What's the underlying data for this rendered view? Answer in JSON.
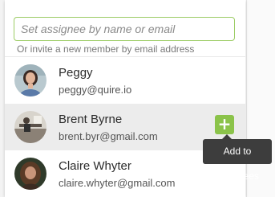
{
  "search": {
    "placeholder": "Set assignee by name or email",
    "value": ""
  },
  "hint": "Or invite a new member by email address",
  "members": [
    {
      "name": "Peggy",
      "email": "peggy@quire.io"
    },
    {
      "name": "Brent Byrne",
      "email": "brent.byr@gmail.com"
    },
    {
      "name": "Claire Whyter",
      "email": "claire.whyter@gmail.com"
    }
  ],
  "add_button": {
    "icon": "plus-icon",
    "glyph": "+"
  },
  "tooltip": "Add to assignees",
  "colors": {
    "accent": "#8bc34a",
    "input_border": "#9ccc65",
    "hover_row": "#ececec",
    "tooltip_bg": "#3d3d3d"
  }
}
